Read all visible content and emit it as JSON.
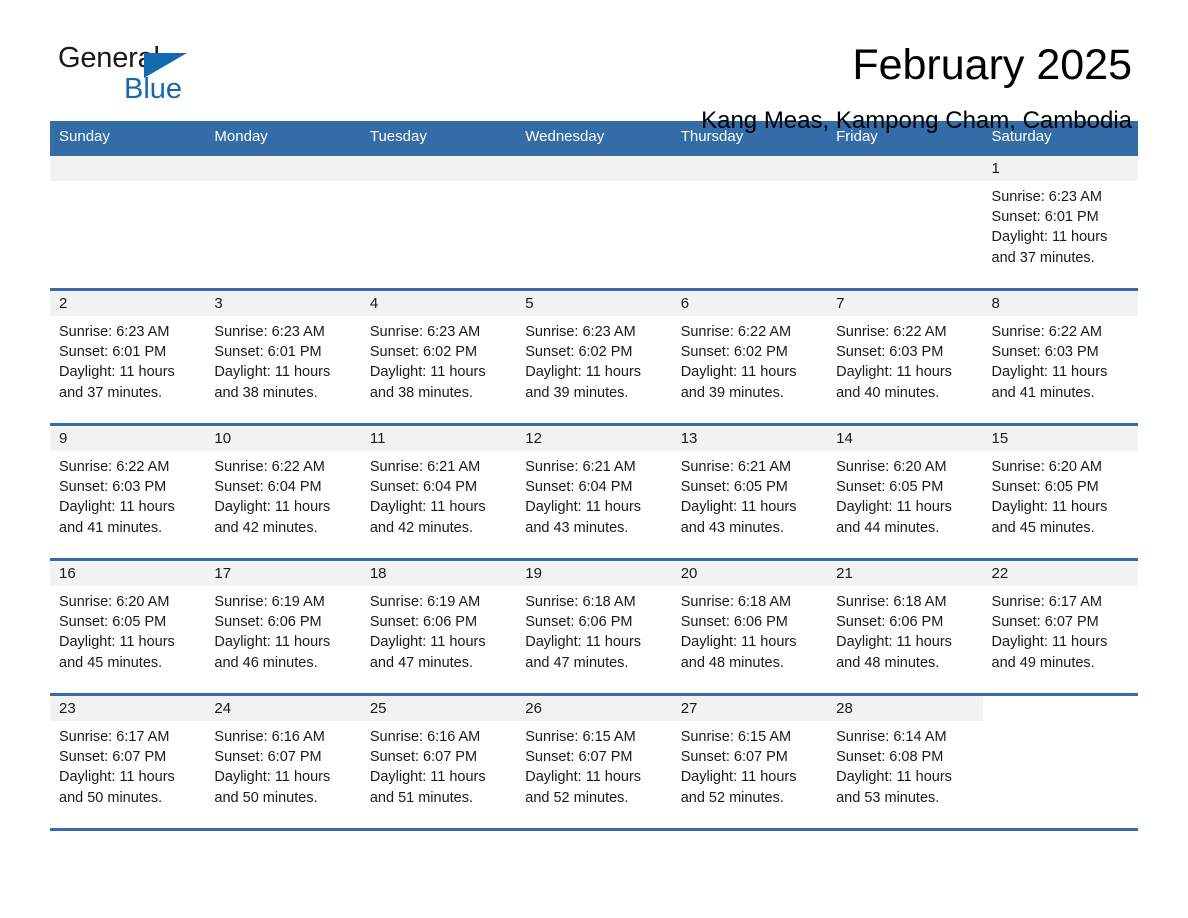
{
  "brand": {
    "name_part1": "General",
    "name_part2": "Blue",
    "flag_icon": "triangle-flag-icon",
    "accent_color": "#1569b0"
  },
  "header": {
    "title": "February 2025",
    "subtitle": "Kang Meas, Kampong Cham, Cambodia"
  },
  "theme": {
    "header_blue": "#336ca6",
    "day_band_gray": "#f2f2f2",
    "text_color": "#1a1a1a"
  },
  "weekday_headers": [
    "Sunday",
    "Monday",
    "Tuesday",
    "Wednesday",
    "Thursday",
    "Friday",
    "Saturday"
  ],
  "weeks": [
    [
      {
        "day": "",
        "lines": [
          "",
          "",
          "",
          ""
        ]
      },
      {
        "day": "",
        "lines": [
          "",
          "",
          "",
          ""
        ]
      },
      {
        "day": "",
        "lines": [
          "",
          "",
          "",
          ""
        ]
      },
      {
        "day": "",
        "lines": [
          "",
          "",
          "",
          ""
        ]
      },
      {
        "day": "",
        "lines": [
          "",
          "",
          "",
          ""
        ]
      },
      {
        "day": "",
        "lines": [
          "",
          "",
          "",
          ""
        ]
      },
      {
        "day": "1",
        "lines": [
          "Sunrise: 6:23 AM",
          "Sunset: 6:01 PM",
          "Daylight: 11 hours",
          "and 37 minutes."
        ]
      }
    ],
    [
      {
        "day": "2",
        "lines": [
          "Sunrise: 6:23 AM",
          "Sunset: 6:01 PM",
          "Daylight: 11 hours",
          "and 37 minutes."
        ]
      },
      {
        "day": "3",
        "lines": [
          "Sunrise: 6:23 AM",
          "Sunset: 6:01 PM",
          "Daylight: 11 hours",
          "and 38 minutes."
        ]
      },
      {
        "day": "4",
        "lines": [
          "Sunrise: 6:23 AM",
          "Sunset: 6:02 PM",
          "Daylight: 11 hours",
          "and 38 minutes."
        ]
      },
      {
        "day": "5",
        "lines": [
          "Sunrise: 6:23 AM",
          "Sunset: 6:02 PM",
          "Daylight: 11 hours",
          "and 39 minutes."
        ]
      },
      {
        "day": "6",
        "lines": [
          "Sunrise: 6:22 AM",
          "Sunset: 6:02 PM",
          "Daylight: 11 hours",
          "and 39 minutes."
        ]
      },
      {
        "day": "7",
        "lines": [
          "Sunrise: 6:22 AM",
          "Sunset: 6:03 PM",
          "Daylight: 11 hours",
          "and 40 minutes."
        ]
      },
      {
        "day": "8",
        "lines": [
          "Sunrise: 6:22 AM",
          "Sunset: 6:03 PM",
          "Daylight: 11 hours",
          "and 41 minutes."
        ]
      }
    ],
    [
      {
        "day": "9",
        "lines": [
          "Sunrise: 6:22 AM",
          "Sunset: 6:03 PM",
          "Daylight: 11 hours",
          "and 41 minutes."
        ]
      },
      {
        "day": "10",
        "lines": [
          "Sunrise: 6:22 AM",
          "Sunset: 6:04 PM",
          "Daylight: 11 hours",
          "and 42 minutes."
        ]
      },
      {
        "day": "11",
        "lines": [
          "Sunrise: 6:21 AM",
          "Sunset: 6:04 PM",
          "Daylight: 11 hours",
          "and 42 minutes."
        ]
      },
      {
        "day": "12",
        "lines": [
          "Sunrise: 6:21 AM",
          "Sunset: 6:04 PM",
          "Daylight: 11 hours",
          "and 43 minutes."
        ]
      },
      {
        "day": "13",
        "lines": [
          "Sunrise: 6:21 AM",
          "Sunset: 6:05 PM",
          "Daylight: 11 hours",
          "and 43 minutes."
        ]
      },
      {
        "day": "14",
        "lines": [
          "Sunrise: 6:20 AM",
          "Sunset: 6:05 PM",
          "Daylight: 11 hours",
          "and 44 minutes."
        ]
      },
      {
        "day": "15",
        "lines": [
          "Sunrise: 6:20 AM",
          "Sunset: 6:05 PM",
          "Daylight: 11 hours",
          "and 45 minutes."
        ]
      }
    ],
    [
      {
        "day": "16",
        "lines": [
          "Sunrise: 6:20 AM",
          "Sunset: 6:05 PM",
          "Daylight: 11 hours",
          "and 45 minutes."
        ]
      },
      {
        "day": "17",
        "lines": [
          "Sunrise: 6:19 AM",
          "Sunset: 6:06 PM",
          "Daylight: 11 hours",
          "and 46 minutes."
        ]
      },
      {
        "day": "18",
        "lines": [
          "Sunrise: 6:19 AM",
          "Sunset: 6:06 PM",
          "Daylight: 11 hours",
          "and 47 minutes."
        ]
      },
      {
        "day": "19",
        "lines": [
          "Sunrise: 6:18 AM",
          "Sunset: 6:06 PM",
          "Daylight: 11 hours",
          "and 47 minutes."
        ]
      },
      {
        "day": "20",
        "lines": [
          "Sunrise: 6:18 AM",
          "Sunset: 6:06 PM",
          "Daylight: 11 hours",
          "and 48 minutes."
        ]
      },
      {
        "day": "21",
        "lines": [
          "Sunrise: 6:18 AM",
          "Sunset: 6:06 PM",
          "Daylight: 11 hours",
          "and 48 minutes."
        ]
      },
      {
        "day": "22",
        "lines": [
          "Sunrise: 6:17 AM",
          "Sunset: 6:07 PM",
          "Daylight: 11 hours",
          "and 49 minutes."
        ]
      }
    ],
    [
      {
        "day": "23",
        "lines": [
          "Sunrise: 6:17 AM",
          "Sunset: 6:07 PM",
          "Daylight: 11 hours",
          "and 50 minutes."
        ]
      },
      {
        "day": "24",
        "lines": [
          "Sunrise: 6:16 AM",
          "Sunset: 6:07 PM",
          "Daylight: 11 hours",
          "and 50 minutes."
        ]
      },
      {
        "day": "25",
        "lines": [
          "Sunrise: 6:16 AM",
          "Sunset: 6:07 PM",
          "Daylight: 11 hours",
          "and 51 minutes."
        ]
      },
      {
        "day": "26",
        "lines": [
          "Sunrise: 6:15 AM",
          "Sunset: 6:07 PM",
          "Daylight: 11 hours",
          "and 52 minutes."
        ]
      },
      {
        "day": "27",
        "lines": [
          "Sunrise: 6:15 AM",
          "Sunset: 6:07 PM",
          "Daylight: 11 hours",
          "and 52 minutes."
        ]
      },
      {
        "day": "28",
        "lines": [
          "Sunrise: 6:14 AM",
          "Sunset: 6:08 PM",
          "Daylight: 11 hours",
          "and 53 minutes."
        ]
      },
      {
        "day": "",
        "lines": [
          "",
          "",
          "",
          ""
        ]
      }
    ]
  ]
}
